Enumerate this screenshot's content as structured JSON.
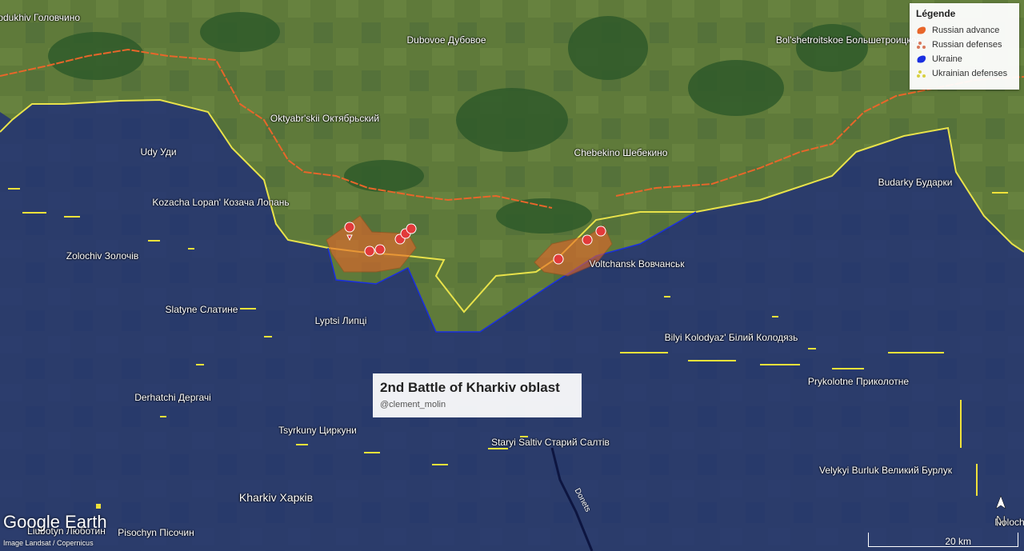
{
  "legend": {
    "title": "Légende",
    "items": [
      {
        "label": "Russian advance",
        "color": "#e8662a",
        "icon": "orange-blob-icon"
      },
      {
        "label": "Russian defenses",
        "color": "#d9785a",
        "icon": "red-dots-icon"
      },
      {
        "label": "Ukraine",
        "color": "#1a2fe0",
        "icon": "blue-blob-icon"
      },
      {
        "label": "Ukrainian defenses",
        "color": "#d8d040",
        "icon": "yellow-dots-icon"
      }
    ]
  },
  "title_box": {
    "title": "2nd Battle of Kharkiv oblast",
    "author": "@clement_molin"
  },
  "places": [
    "Bogodukhiv Головчино",
    "Dubovoe Дубовое",
    "Bol'shetroitskoe Большетроицкое",
    "Oktyabr'skii Октябрьский",
    "Udy Уди",
    "Chebekino Шебекино",
    "Kozacha Lopan' Козача Лопань",
    "Budarky Бударки",
    "Zolochiv Золочів",
    "Voltchansk Вовчанськ",
    "Slatyne Слатине",
    "Lyptsi Липці",
    "Bilyi Kolodyaz' Білий Колодязь",
    "Prykolotne Приколотне",
    "Derhatchi Дергачі",
    "Tsyrkuny Циркуни",
    "Staryi Saltiv Старий Салтів",
    "Velykyi Burluk Великий Бурлук",
    "Kharkiv Харків",
    "Liubotyn Люботин",
    "Pisochyn Пісочин",
    "Noloch"
  ],
  "river": "Donets",
  "branding": {
    "logo": "Google Earth",
    "credit": "Image Landsat / Copernicus"
  },
  "scale": {
    "label": "20 km"
  },
  "compass": {
    "label": "N"
  }
}
